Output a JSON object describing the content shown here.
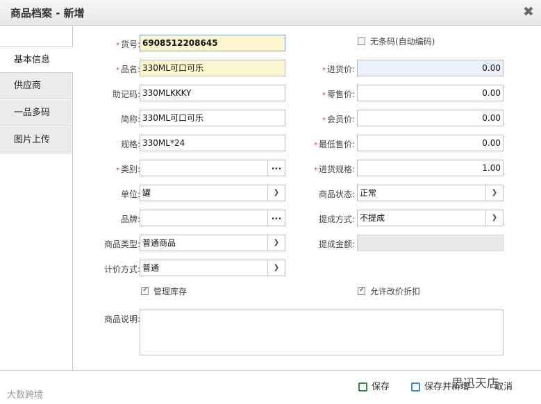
{
  "window": {
    "title": "商品档案 - 新增",
    "close_icon": "close-icon"
  },
  "tabs": [
    {
      "label": "基本信息",
      "active": true
    },
    {
      "label": "供应商",
      "active": false
    },
    {
      "label": "一品多码",
      "active": false
    },
    {
      "label": "图片上传",
      "active": false
    }
  ],
  "left": {
    "barcode": {
      "label": "货号:",
      "required": "*",
      "value": "6908512208645"
    },
    "name": {
      "label": "品名:",
      "required": "*",
      "value": "330ML可口可乐"
    },
    "mnemonic": {
      "label": "助记码:",
      "value": "330MLKKKY"
    },
    "short_name": {
      "label": "简称:",
      "value": "330ML可口可乐"
    },
    "spec": {
      "label": "规格:",
      "value": "330ML*24"
    },
    "category": {
      "label": "类别:",
      "required": "*",
      "value": "",
      "button": "..."
    },
    "unit": {
      "label": "单位:",
      "value": "罐"
    },
    "brand": {
      "label": "品牌:",
      "value": "",
      "button": "..."
    },
    "product_type": {
      "label": "商品类型:",
      "value": "普通商品"
    },
    "pricing": {
      "label": "计价方式:",
      "value": "普通"
    },
    "manage_stock": {
      "label": "管理库存",
      "checked": true
    },
    "description": {
      "label": "商品说明:",
      "value": ""
    }
  },
  "right": {
    "no_barcode": {
      "label": "无条码(自动编码)",
      "checked": false
    },
    "purchase_price": {
      "label": "进货价:",
      "required": "*",
      "value": "0.00"
    },
    "retail_price": {
      "label": "零售价:",
      "required": "*",
      "value": "0.00"
    },
    "member_price": {
      "label": "会员价:",
      "required": "*",
      "value": "0.00"
    },
    "min_price": {
      "label": "最低售价:",
      "required": "*",
      "value": "0.00"
    },
    "purchase_spec": {
      "label": "进货规格:",
      "required": "*",
      "value": "1.00"
    },
    "status": {
      "label": "商品状态:",
      "value": "正常"
    },
    "commission_method": {
      "label": "提成方式:",
      "value": "不提成"
    },
    "commission_amount": {
      "label": "提成金额:",
      "value": ""
    },
    "allow_discount": {
      "label": "允许改价折扣",
      "checked": true
    }
  },
  "footer": {
    "save": "保存",
    "save_new": "保存并新增",
    "cancel": "取消"
  },
  "watermarks": {
    "left": "大数跨境",
    "right": "思迅天店"
  },
  "colors": {
    "required": "#dd3333",
    "focus_yellow": "#fbf6cf",
    "save_icon": "#2e8b3a"
  }
}
